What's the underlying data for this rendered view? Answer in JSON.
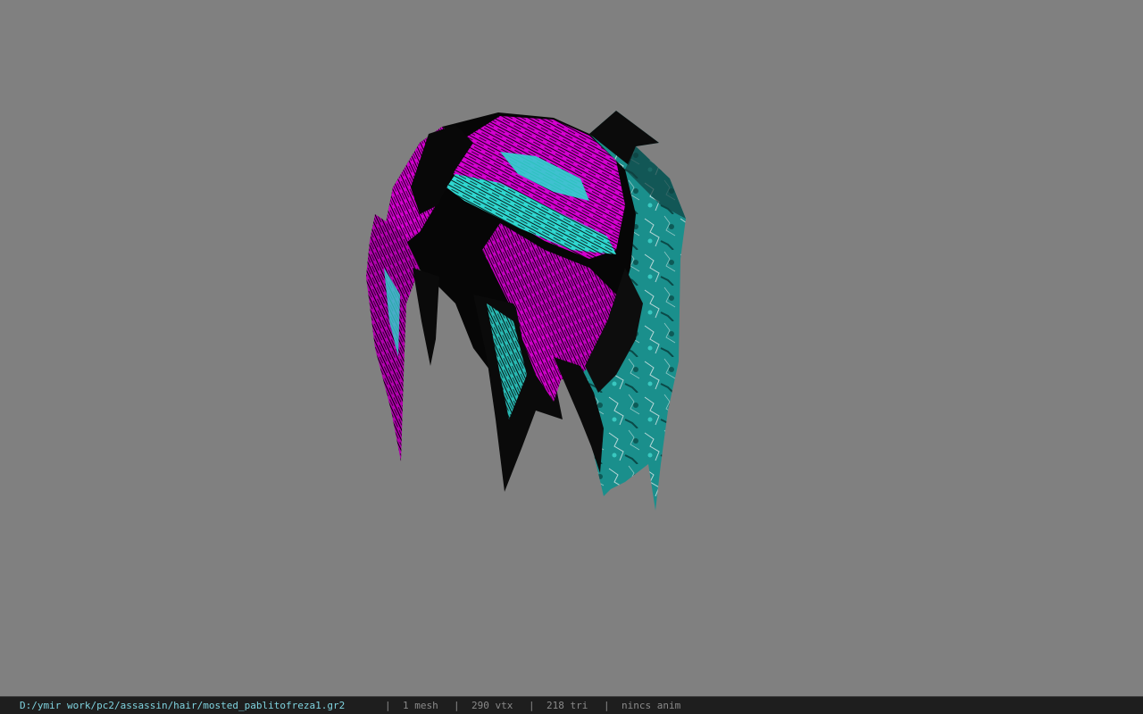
{
  "viewer": {
    "background_color": "#808080",
    "model_colors": {
      "base": "#050505",
      "magenta": "#e000d8",
      "cyan": "#2fd6cf",
      "teal": "#1a8f8c"
    }
  },
  "statusbar": {
    "path": "D:/ymir work/pc2/assassin/hair/mosted_pablitofreza1.gr2",
    "sep": "|",
    "mesh": "1 mesh",
    "vtx": "290 vtx",
    "tri": "218 tri",
    "anim": "nincs anim",
    "path_color": "#7fd3df",
    "text_color": "#8a8a8a"
  }
}
